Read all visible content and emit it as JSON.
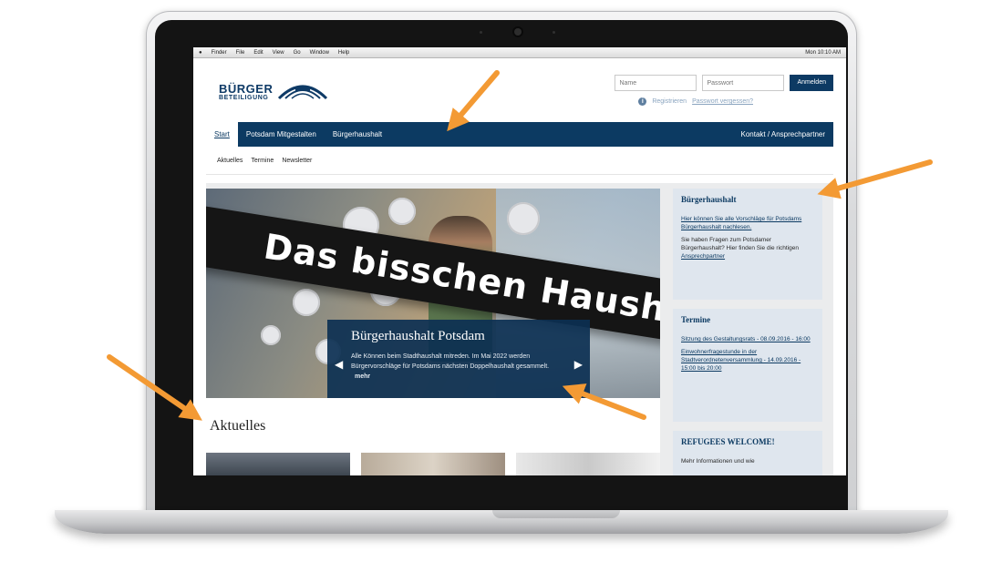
{
  "menubar": {
    "items": [
      "Finder",
      "File",
      "Edit",
      "View",
      "Go",
      "Window",
      "Help"
    ],
    "right": "Mon 10:10 AM"
  },
  "site": {
    "logo": {
      "line1": "BÜRGER",
      "line2": "BETEILIGUNG"
    },
    "login": {
      "name_placeholder": "Name",
      "password_placeholder": "Passwort",
      "button": "Anmelden",
      "register": "Registrieren",
      "forgot": "Passwort vergessen?"
    },
    "nav": {
      "tabs": [
        "Start",
        "Potsdam Mitgestalten",
        "Bürgerhaushalt"
      ],
      "right": "Kontakt / Ansprechpartner"
    },
    "subnav": [
      "Aktuelles",
      "Termine",
      "Newsletter"
    ],
    "slider": {
      "sign_text": "Das bisschen Haushalt",
      "title": "Bürgerhaushalt Potsdam",
      "text": "Alle Können beim Stadthaushalt mitreden. Im Mai 2022 werden Bürgervorschläge für Potsdams nächsten Doppelhaushalt gesammelt.",
      "more": "mehr"
    },
    "aktuelles": "Aktuelles",
    "sidebar": {
      "haushalt": {
        "title": "Bürgerhaushalt",
        "link": "Hier können Sie alle Vorschläge für Potsdams Bürgerhaushalt nachlesen.",
        "text": "Sie haben Fragen zum Potsdamer Bürgerhaushalt? Hier finden Sie die richtigen",
        "text_link": "Ansprechpartner"
      },
      "termine": {
        "title": "Termine",
        "item1": "Sitzung des Gestaltungsrats - 08.09.2016 - 16:00",
        "item2": "Einwohnerfragestunde in der Stadtverordnetenversammlung - 14.09.2016 - 15:00 bis 20:00"
      },
      "refugees": {
        "title": "REFUGEES WELCOME!",
        "text": "Mehr Informationen und wie"
      }
    }
  },
  "colors": {
    "brand": "#0c3a62",
    "arrow": "#f39a34",
    "sidebar_bg": "#dfe6ee"
  }
}
